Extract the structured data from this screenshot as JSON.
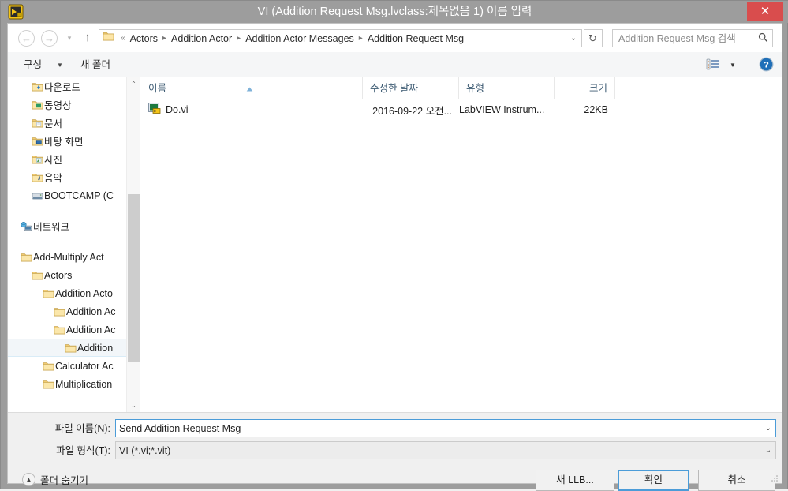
{
  "window": {
    "title": "VI (Addition Request Msg.lvclass:제목없음 1) 이름 입력",
    "app_icon": "labview-vi-icon",
    "close_label": "✕",
    "titlebar_color": "#9d9d9d",
    "close_color": "#d94d4d"
  },
  "addressbar": {
    "back_icon": "←",
    "forward_icon": "→",
    "history_icon": "▾",
    "up_icon": "↑",
    "folder_icon": "folder-icon",
    "prefix": "«",
    "crumbs": [
      "Actors",
      "Addition Actor",
      "Addition Actor Messages",
      "Addition Request Msg"
    ],
    "separator": "▸",
    "dropdown_icon": "⌄",
    "refresh_icon": "↻"
  },
  "search": {
    "placeholder": "Addition Request Msg 검색",
    "value": "",
    "icon": "search-icon"
  },
  "toolbar": {
    "organize_label": "구성",
    "organize_caret": "▼",
    "new_folder_label": "새 폴더",
    "view_options_icon": "view-list-icon",
    "view_options_caret": "▼",
    "help_icon": "help-icon"
  },
  "nav_pane": {
    "items": [
      {
        "label": "다운로드",
        "icon": "folder-downloads-icon",
        "indent": 28,
        "selected": false,
        "spacer_before": false
      },
      {
        "label": "동영상",
        "icon": "folder-videos-icon",
        "indent": 28,
        "selected": false,
        "spacer_before": false
      },
      {
        "label": "문서",
        "icon": "folder-documents-icon",
        "indent": 28,
        "selected": false,
        "spacer_before": false
      },
      {
        "label": "바탕 화면",
        "icon": "folder-desktop-icon",
        "indent": 28,
        "selected": false,
        "spacer_before": false
      },
      {
        "label": "사진",
        "icon": "folder-pictures-icon",
        "indent": 28,
        "selected": false,
        "spacer_before": false
      },
      {
        "label": "음악",
        "icon": "folder-music-icon",
        "indent": 28,
        "selected": false,
        "spacer_before": false
      },
      {
        "label": "BOOTCAMP (C",
        "icon": "drive-icon",
        "indent": 28,
        "selected": false,
        "spacer_before": false
      },
      {
        "label": "네트워크",
        "icon": "network-icon",
        "indent": 14,
        "selected": false,
        "spacer_before": true
      },
      {
        "label": "Add-Multiply Act",
        "icon": "folder-icon",
        "indent": 14,
        "selected": false,
        "spacer_before": true
      },
      {
        "label": "Actors",
        "icon": "folder-icon",
        "indent": 28,
        "selected": false,
        "spacer_before": false
      },
      {
        "label": "Addition Acto",
        "icon": "folder-icon",
        "indent": 42,
        "selected": false,
        "spacer_before": false
      },
      {
        "label": "Addition Ac",
        "icon": "folder-icon",
        "indent": 56,
        "selected": false,
        "spacer_before": false
      },
      {
        "label": "Addition Ac",
        "icon": "folder-icon",
        "indent": 56,
        "selected": false,
        "spacer_before": false
      },
      {
        "label": "Addition",
        "icon": "folder-icon",
        "indent": 70,
        "selected": true,
        "spacer_before": false
      },
      {
        "label": "Calculator Ac",
        "icon": "folder-icon",
        "indent": 42,
        "selected": false,
        "spacer_before": false
      },
      {
        "label": "Multiplication",
        "icon": "folder-icon",
        "indent": 42,
        "selected": false,
        "spacer_before": false
      }
    ],
    "scrollbar": {
      "up_icon": "⌃",
      "down_icon": "⌄"
    }
  },
  "file_list": {
    "columns": [
      {
        "key": "name",
        "label": "이름",
        "sorted": "asc"
      },
      {
        "key": "date",
        "label": "수정한 날짜",
        "sorted": ""
      },
      {
        "key": "type",
        "label": "유형",
        "sorted": ""
      },
      {
        "key": "size",
        "label": "크기",
        "sorted": ""
      }
    ],
    "rows": [
      {
        "name": "Do.vi",
        "icon": "labview-vi-file-icon",
        "date": "2016-09-22 오전...",
        "type": "LabVIEW Instrum...",
        "size": "22KB"
      }
    ]
  },
  "form": {
    "filename_label": "파일 이름(N):",
    "filename_value": "Send Addition Request Msg",
    "filename_placeholder": "",
    "filename_caret": "⌄",
    "filetype_label": "파일 형식(T):",
    "filetype_value": "VI (*.vi;*.vit)",
    "filetype_caret": "⌄"
  },
  "buttons": {
    "hide_folders_label": "폴더 숨기기",
    "hide_folders_icon": "▲",
    "new_llb_label": "새 LLB...",
    "ok_label": "확인",
    "cancel_label": "취소",
    "focus_color": "#4b9cd8"
  }
}
